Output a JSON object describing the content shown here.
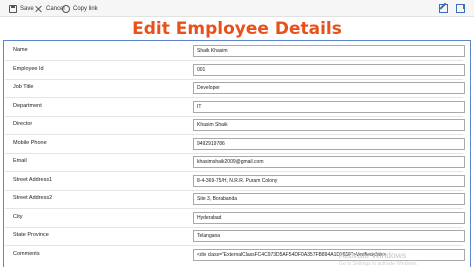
{
  "toolbar": {
    "save_label": "Save",
    "cancel_label": "Cancel",
    "copy_link_label": "Copy link"
  },
  "page": {
    "title": "Edit Employee Details"
  },
  "form": {
    "fields": [
      {
        "label": "Name",
        "value": "Shaik Khasim"
      },
      {
        "label": "Employee Id",
        "value": "001"
      },
      {
        "label": "Job Title",
        "value": "Developer"
      },
      {
        "label": "Department",
        "value": "IT"
      },
      {
        "label": "Director",
        "value": "Khasim Shaik"
      },
      {
        "label": "Mobile Phone",
        "value": "9492919786"
      },
      {
        "label": "Email",
        "value": "khasimshaik2009@gmail.com"
      },
      {
        "label": "Street Address1",
        "value": "8-4-369-75/H, N.R.R. Puram Colony"
      },
      {
        "label": "Street Address2",
        "value": "Site 3, Borabanda"
      },
      {
        "label": "City",
        "value": "Hyderabad"
      },
      {
        "label": "State Province",
        "value": "Telangana"
      },
      {
        "label": "Comments",
        "value": "<div class=\"ExternalClassFC4C973D5AF54DF0A357FB894A1D265F\">Verified</div>"
      }
    ]
  },
  "watermark": {
    "text": "Activate Windows",
    "subtext": "Go to Settings to activate Windows."
  }
}
